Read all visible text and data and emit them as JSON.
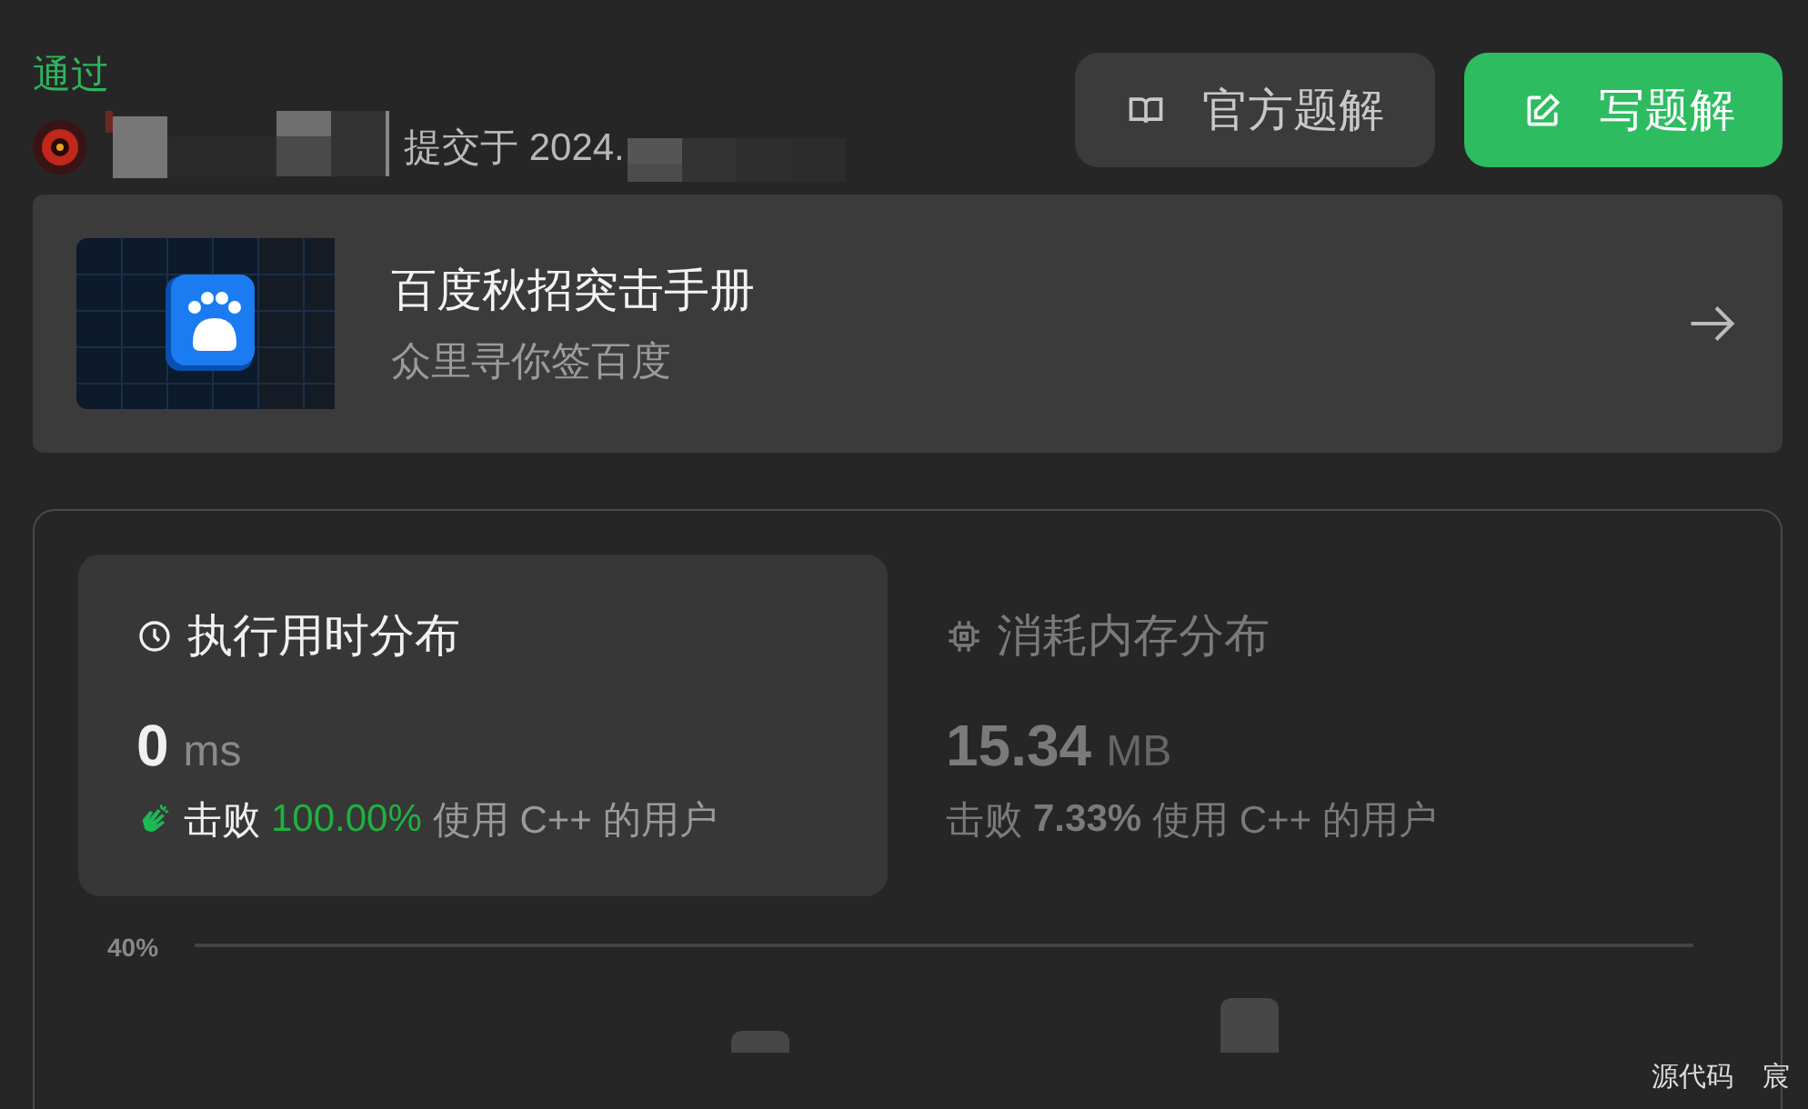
{
  "status": "通过",
  "submission": {
    "submitted_text": "提交于 2024."
  },
  "buttons": [
    {
      "kind": "book",
      "label": "官方题解"
    },
    {
      "kind": "edit",
      "label": "写题解"
    }
  ],
  "banner": {
    "title": "百度秋招突击手册",
    "subtitle": "众里寻你签百度"
  },
  "stats": [
    {
      "kind": "time",
      "title": "执行用时分布",
      "value": "0",
      "unit": "ms",
      "beat_label": "击败",
      "beat_percent": "100.00%",
      "beat_suffix": "使用 C++ 的用户",
      "selected": true
    },
    {
      "kind": "memory",
      "title": "消耗内存分布",
      "value": "15.34",
      "unit": "MB",
      "beat_label": "击败",
      "beat_percent": "7.33%",
      "beat_suffix": "使用 C++ 的用户",
      "selected": false
    }
  ],
  "chart": {
    "ytick": "40%"
  },
  "overlay": [
    "源代码",
    "宸"
  ]
}
